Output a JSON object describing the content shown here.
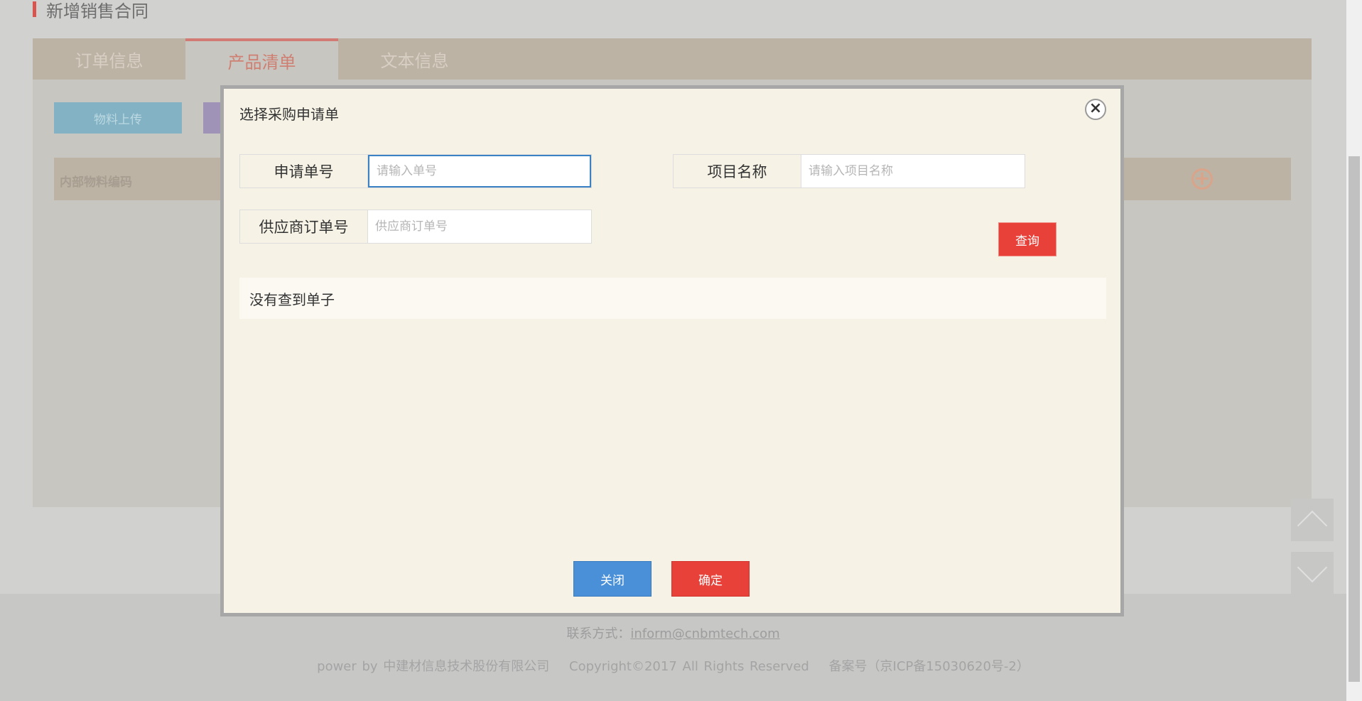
{
  "page": {
    "title": "新增销售合同",
    "tabs": [
      "订单信息",
      "产品清单",
      "文本信息"
    ],
    "active_tab": "产品清单",
    "upload_button": "物料上传",
    "table_header": "内部物料编码"
  },
  "modal": {
    "title": "选择采购申请单",
    "close_icon": "close-icon",
    "fields": {
      "request_no": {
        "label": "申请单号",
        "placeholder": "请输入单号",
        "value": ""
      },
      "project_name": {
        "label": "项目名称",
        "placeholder": "请输入项目名称",
        "value": ""
      },
      "supplier_order_no": {
        "label": "供应商订单号",
        "placeholder": "供应商订单号",
        "value": ""
      }
    },
    "search_button": "查询",
    "result_message": "没有查到单子",
    "close_button": "关闭",
    "confirm_button": "确定"
  },
  "footer": {
    "contact_label": "联系方式：",
    "contact_email": "inform@cnbmtech.com",
    "power": "power by 中建材信息技术股份有限公司",
    "copyright": "Copyright©2017 All Rights Reserved",
    "icp": "备案号（京ICP备15030620号-2）"
  },
  "colors": {
    "accent_red": "#e84139",
    "accent_blue": "#4a90d9",
    "modal_bg": "#f6f3e6"
  }
}
